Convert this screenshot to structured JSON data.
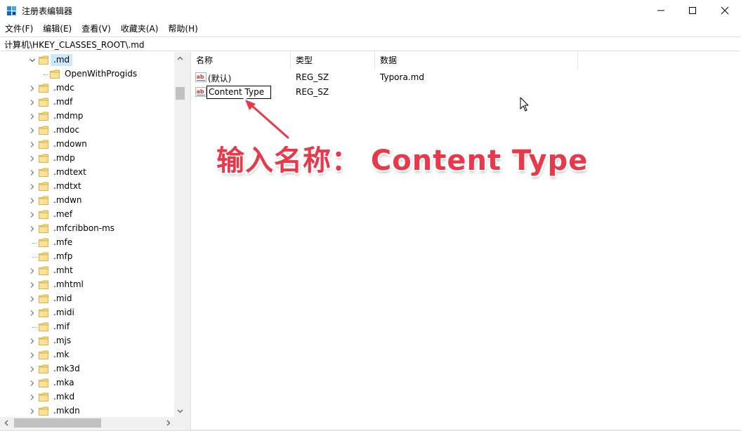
{
  "window": {
    "title": "注册表编辑器"
  },
  "menu": [
    "文件(F)",
    "编辑(E)",
    "查看(V)",
    "收藏夹(A)",
    "帮助(H)"
  ],
  "address": "计算机\\HKEY_CLASSES_ROOT\\.md",
  "tree": {
    "selected": ".md",
    "child": "OpenWithProgids",
    "items": [
      ".mdc",
      ".mdf",
      ".mdmp",
      ".mdoc",
      ".mdown",
      ".mdp",
      ".mdtext",
      ".mdtxt",
      ".mdwn",
      ".mef",
      ".mfcribbon-ms",
      ".mfe",
      ".mfp",
      ".mht",
      ".mhtml",
      ".mid",
      ".midi",
      ".mif",
      ".mjs",
      ".mk",
      ".mk3d",
      ".mka",
      ".mkd",
      ".mkdn"
    ],
    "no_toggle": [
      ".mfe",
      ".mfp",
      ".mif"
    ]
  },
  "columns": {
    "name": "名称",
    "type": "类型",
    "data": "数据"
  },
  "values": [
    {
      "name": "(默认)",
      "type": "REG_SZ",
      "data": "Typora.md"
    },
    {
      "name": "Content Type",
      "type": "REG_SZ",
      "data": ""
    }
  ],
  "annotation": "输入名称： Content Type",
  "colors": {
    "selection": "#cce8ff",
    "annotation": "#e8394a",
    "folder": "#f8d775"
  }
}
